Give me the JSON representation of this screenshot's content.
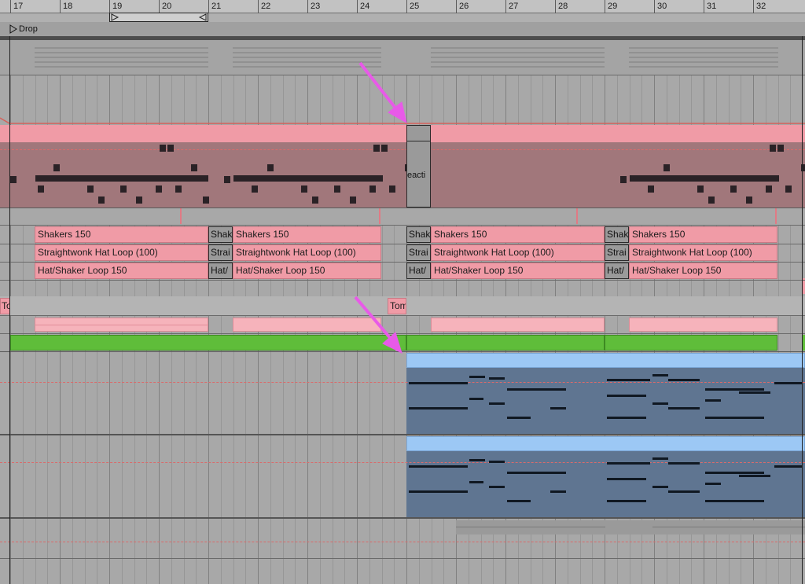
{
  "ruler": {
    "bars": [
      "17",
      "18",
      "19",
      "20",
      "21",
      "22",
      "23",
      "24",
      "25",
      "26",
      "27",
      "28",
      "29",
      "30",
      "31",
      "32"
    ]
  },
  "locator": {
    "label": "Drop"
  },
  "clips": {
    "shakers": "Shakers 150",
    "straightwonk": "Straightwonk Hat Loop (100)",
    "hat_shaker": "Hat/Shaker Loop 150",
    "short_shakers": "Shak",
    "short_straight": "Strai",
    "short_hat": "Hat/",
    "tom": "Tom",
    "tom_short": "To",
    "deacti": "eacti"
  },
  "colors": {
    "clip_pink": "#f09ba6",
    "drum_track_bg": "#a1777b",
    "clip_green": "#5fbd3a",
    "clip_blue_header": "#9cc8f5",
    "clip_blue_body": "#5f7591",
    "arrow_magenta": "#e85ae8"
  },
  "annotations": {
    "arrows": 2
  }
}
